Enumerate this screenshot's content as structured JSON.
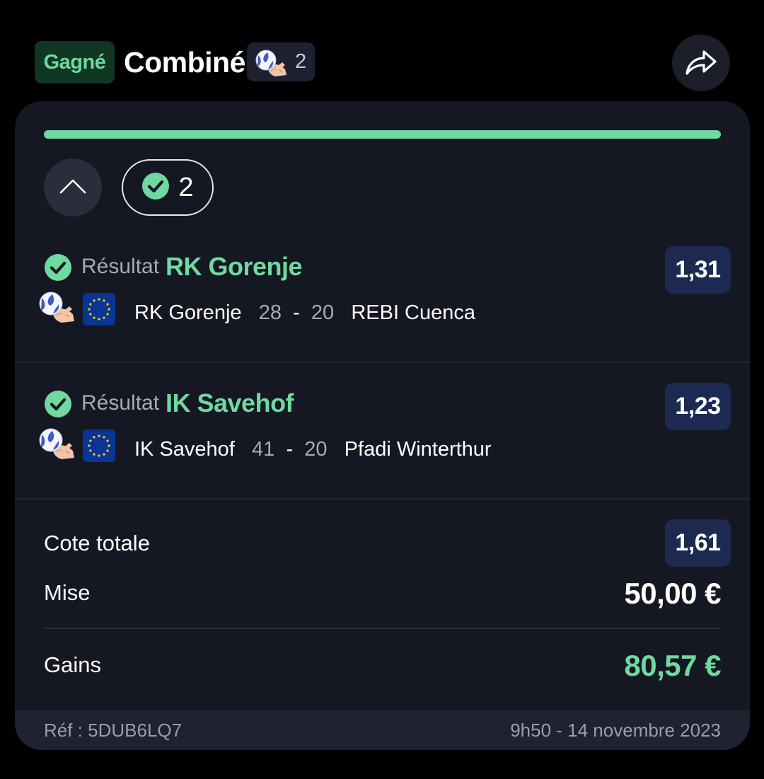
{
  "header": {
    "status_badge": "Gagné",
    "title": "Combiné",
    "selection_count": "2",
    "share_icon": "share-arrow-icon"
  },
  "bet": {
    "progress_fraction": 1.0,
    "won_count": "2",
    "selections": [
      {
        "market": "Résultat",
        "pick": "RK Gorenje",
        "odds": "1,31",
        "home": "RK Gorenje",
        "home_score": "28",
        "dash": "-",
        "away_score": "20",
        "away": "REBI Cuenca",
        "sport_icon": "handball-icon",
        "competition_icon": "eu-flag-icon"
      },
      {
        "market": "Résultat",
        "pick": "IK Savehof",
        "odds": "1,23",
        "home": "IK Savehof",
        "home_score": "41",
        "dash": "-",
        "away_score": "20",
        "away": "Pfadi Winterthur",
        "sport_icon": "handball-icon",
        "competition_icon": "eu-flag-icon"
      }
    ],
    "total_odds_label": "Cote totale",
    "total_odds": "1,61",
    "stake_label": "Mise",
    "stake": "50,00 €",
    "winnings_label": "Gains",
    "winnings": "80,57 €",
    "reference": "Réf : 5DUB6LQ7",
    "datetime": "9h50 - 14 novembre 2023"
  },
  "colors": {
    "accent_green": "#6fd9a0",
    "odds_bg": "#1c2a52",
    "card_bg": "#151722"
  }
}
